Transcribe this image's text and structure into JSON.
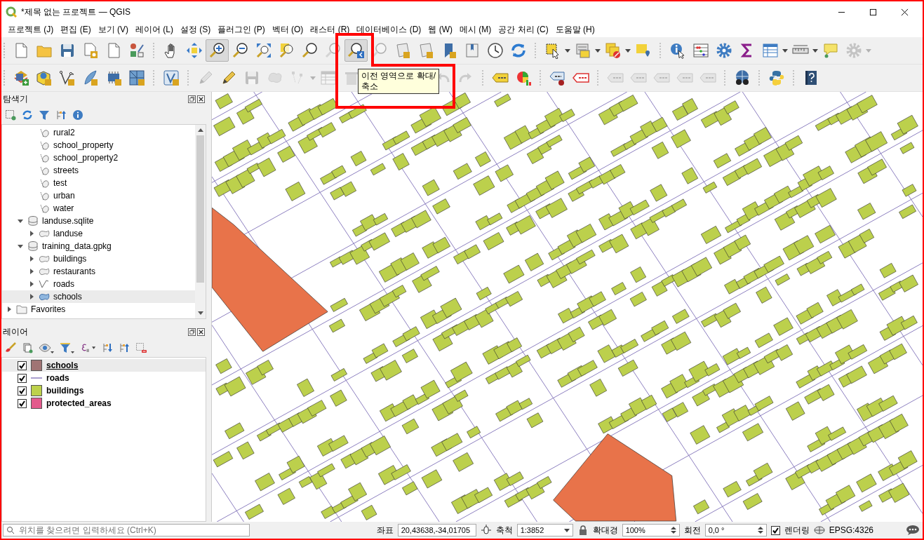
{
  "window": {
    "title": "*제목 없는 프로젝트 — QGIS"
  },
  "menu": [
    "프로젝트 (J)",
    "편집 (E)",
    "보기 (V)",
    "레이어 (L)",
    "설정 (S)",
    "플러그인 (P)",
    "벡터 (O)",
    "래스터 (R)",
    "데이터베이스 (D)",
    "웹 (W)",
    "메시 (M)",
    "공간 처리 (C)",
    "도움말 (H)"
  ],
  "toolbar_1": [
    {
      "disabled": false,
      "selected": false
    },
    {
      "disabled": false,
      "selected": false
    },
    {
      "disabled": false,
      "selected": false
    },
    {
      "disabled": false,
      "selected": false
    },
    {
      "disabled": false,
      "selected": false
    },
    {
      "disabled": false,
      "selected": false
    },
    {
      "disabled": false,
      "selected": false
    },
    {
      "disabled": false,
      "selected": false
    },
    {
      "disabled": false,
      "selected": true
    },
    {
      "disabled": false,
      "selected": false
    },
    {
      "disabled": false,
      "selected": false
    },
    {
      "disabled": false,
      "selected": false
    },
    {
      "disabled": false,
      "selected": false
    },
    {
      "disabled": true,
      "selected": false
    },
    {
      "disabled": false,
      "selected": true
    },
    {
      "disabled": true,
      "selected": false
    },
    {
      "disabled": false,
      "selected": false
    },
    {
      "disabled": false,
      "selected": false
    },
    {
      "disabled": false,
      "selected": false
    },
    {
      "disabled": false,
      "selected": false
    },
    {
      "disabled": false,
      "selected": false
    },
    {
      "disabled": false,
      "selected": false
    },
    {
      "disabled": false,
      "selected": false
    },
    {
      "disabled": false,
      "selected": false
    },
    {
      "disabled": false,
      "selected": false
    },
    {
      "disabled": false,
      "selected": false
    },
    {
      "disabled": false,
      "selected": false
    },
    {
      "disabled": false,
      "selected": false
    },
    {
      "disabled": false,
      "selected": false
    },
    {
      "disabled": false,
      "selected": false
    },
    {
      "disabled": false,
      "selected": false
    },
    {
      "disabled": false,
      "selected": false
    },
    {
      "disabled": false,
      "selected": false
    },
    {
      "disabled": true,
      "selected": false
    }
  ],
  "toolbar_2": [
    {
      "disabled": false
    },
    {
      "disabled": false
    },
    {
      "disabled": false
    },
    {
      "disabled": false
    },
    {
      "disabled": false
    },
    {
      "disabled": false
    },
    {
      "disabled": false
    },
    {
      "disabled": true
    },
    {
      "disabled": false
    },
    {
      "disabled": true
    },
    {
      "disabled": true
    },
    {
      "disabled": true
    },
    {
      "disabled": true
    },
    {
      "disabled": true
    },
    {
      "disabled": true
    },
    {
      "disabled": true
    },
    {
      "disabled": false
    },
    {
      "disabled": false
    },
    {
      "disabled": false
    },
    {
      "disabled": false
    },
    {
      "disabled": true
    },
    {
      "disabled": true
    },
    {
      "disabled": true
    },
    {
      "disabled": true
    },
    {
      "disabled": true
    },
    {
      "disabled": false
    },
    {
      "disabled": false
    },
    {
      "disabled": false
    }
  ],
  "tooltip": {
    "text": "이전 영역으로 확대/\n축소"
  },
  "browser": {
    "title": "탐색기",
    "tree": [
      {
        "children": [
          {
            "children": [
              {
                "label": "rural2",
                "kind": "vector-file",
                "selected": false
              },
              {
                "label": "school_property",
                "kind": "vector-file",
                "selected": false
              },
              {
                "label": "school_property2",
                "kind": "vector-file",
                "selected": false
              },
              {
                "label": "streets",
                "kind": "vector-file",
                "selected": false
              },
              {
                "label": "test",
                "kind": "vector-file",
                "selected": false
              },
              {
                "label": "urban",
                "kind": "vector-file",
                "selected": false
              },
              {
                "label": "water",
                "kind": "vector-file",
                "selected": false
              }
            ]
          },
          {
            "label": "landuse.sqlite",
            "kind": "database",
            "expanded": true,
            "selected": false,
            "children": [
              {
                "label": "landuse",
                "kind": "polygon-layer",
                "expanded": false,
                "selected": false
              }
            ]
          },
          {
            "label": "training_data.gpkg",
            "kind": "database",
            "expanded": true,
            "selected": false,
            "children": [
              {
                "label": "buildings",
                "kind": "polygon-layer",
                "expanded": false,
                "selected": false
              },
              {
                "label": "restaurants",
                "kind": "polygon-layer",
                "expanded": false,
                "selected": false
              },
              {
                "label": "roads",
                "kind": "line-layer",
                "expanded": false,
                "selected": false
              },
              {
                "label": "schools",
                "kind": "polygon-layer",
                "expanded": false,
                "selected": true
              }
            ]
          }
        ]
      },
      {
        "label": "Favorites",
        "kind": "folder",
        "expanded": false,
        "selected": false
      }
    ]
  },
  "layers": {
    "title": "레이어",
    "items": [
      {
        "label": "schools",
        "kind": "fill",
        "color": "#a07474",
        "checked": true,
        "selected": true
      },
      {
        "label": "roads",
        "kind": "line",
        "color": "#a99fcf",
        "checked": true,
        "selected": false
      },
      {
        "label": "buildings",
        "kind": "fill",
        "color": "#bdd14b",
        "checked": true,
        "selected": false
      },
      {
        "label": "protected_areas",
        "kind": "fill",
        "color": "#e35a8c",
        "checked": true,
        "selected": false
      }
    ]
  },
  "status_bar": {
    "search": {
      "placeholder": "위치를 찾으려면 입력하세요 (Ctrl+K)"
    },
    "coordinate_label": "좌표",
    "coordinate": "20,43638,-34,01705",
    "scale_label": "축척",
    "scale": "1:3852",
    "magnifier_label": "확대경",
    "magnifier": "100%",
    "rotation_label": "회전",
    "rotation": "0,0 °",
    "render": {
      "label": "렌더링",
      "checked": true
    },
    "crs": "EPSG:4326"
  }
}
